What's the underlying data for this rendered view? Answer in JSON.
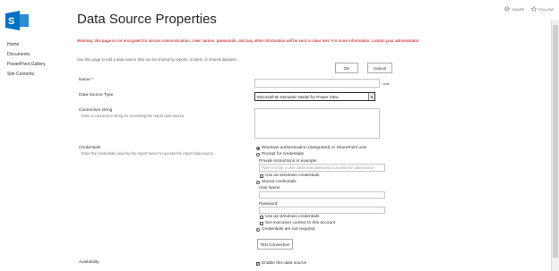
{
  "header": {
    "title": "Data Source Properties",
    "share_label": "SHARE",
    "follow_label": "FOLLOW"
  },
  "nav": {
    "items": [
      "Home",
      "Documents",
      "PowerPivot Gallery",
      "Site Contents"
    ]
  },
  "messages": {
    "warning": "Warning: this page is not encrypted for secure communication. User names, passwords, and any other information will be sent in clear text. For more information, contact your administrator.",
    "intro": "Use this page to edit a data source that can be shared by reports, models, or shared datasets."
  },
  "buttons": {
    "ok": "OK",
    "cancel": "Cancel",
    "test_connection": "Test Connection"
  },
  "form": {
    "name_label": "Name",
    "name_required": "*",
    "name_value": "",
    "name_suffix": ".rsds",
    "type_label": "Data Source Type",
    "type_value": "Microsoft BI Semantic Model for Power View",
    "conn_label": "Connection string",
    "conn_desc": "Enter a connection string for accessing the report data source.",
    "conn_value": "",
    "cred_label": "Credentials",
    "cred_desc": "Enter the credentials used by the report server to access the report data source.",
    "opt_windows": "Windows authentication (integrated) or SharePoint user",
    "opt_prompt": "Prompt for credentials",
    "prompt_instr_label": "Provide instructions or example:",
    "prompt_instr_placeholder": "Type or enter a user name and password to access the data source",
    "use_windows_cred_1": "Use as Windows credentials",
    "opt_stored": "Stored credentials",
    "username_label": "User Name:",
    "password_label": "Password:",
    "use_windows_cred_2": "Use as Windows credentials",
    "set_exec_context": "Set execution context to this account",
    "opt_not_required": "Credentials are not required",
    "availability_label": "Availability",
    "enable_label": "Enable this data source"
  },
  "state": {
    "selected_credential": "windows",
    "enable_checked": true
  }
}
